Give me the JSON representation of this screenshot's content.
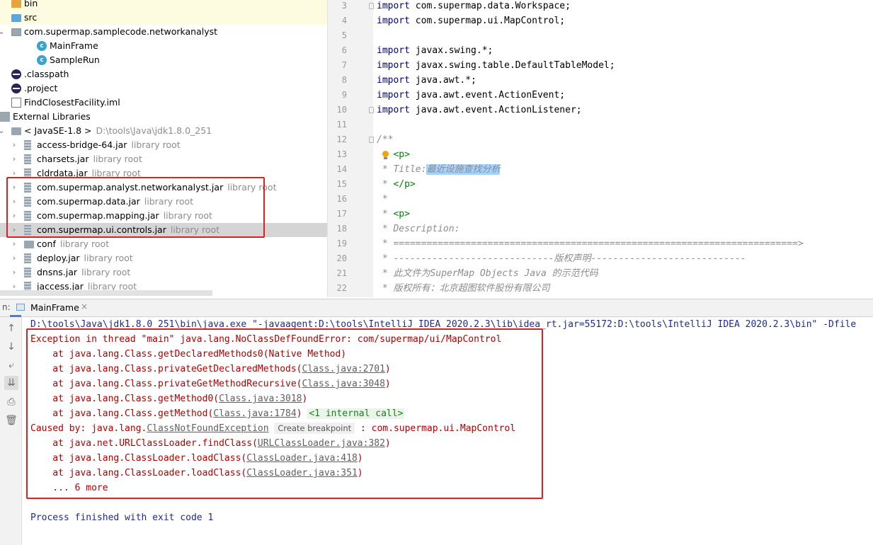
{
  "project_tree": {
    "items": [
      {
        "label": "bin",
        "sub": "",
        "icon": "folder-orange-icon"
      },
      {
        "label": "src",
        "sub": "",
        "icon": "folder-blue-icon"
      },
      {
        "label": "com.supermap.samplecode.networkanalyst",
        "sub": "",
        "icon": "package-icon"
      },
      {
        "label": "MainFrame",
        "sub": "",
        "icon": "java-class-icon"
      },
      {
        "label": "SampleRun",
        "sub": "",
        "icon": "java-class-icon"
      },
      {
        "label": ".classpath",
        "sub": "",
        "icon": "eclipse-icon"
      },
      {
        "label": ".project",
        "sub": "",
        "icon": "eclipse-icon"
      },
      {
        "label": "FindClosestFacility.iml",
        "sub": "",
        "icon": "file-icon"
      },
      {
        "label": "External Libraries",
        "sub": "",
        "icon": "libraries-icon"
      },
      {
        "label": "< JavaSE-1.8 >",
        "sub": "D:\\tools\\Java\\jdk1.8.0_251",
        "icon": "jdk-folder-icon"
      },
      {
        "label": "access-bridge-64.jar",
        "sub": "library root",
        "icon": "jar-icon"
      },
      {
        "label": "charsets.jar",
        "sub": "library root",
        "icon": "jar-icon"
      },
      {
        "label": "cldrdata.jar",
        "sub": "library root",
        "icon": "jar-icon"
      },
      {
        "label": "com.supermap.analyst.networkanalyst.jar",
        "sub": "library root",
        "icon": "jar-icon"
      },
      {
        "label": "com.supermap.data.jar",
        "sub": "library root",
        "icon": "jar-icon"
      },
      {
        "label": "com.supermap.mapping.jar",
        "sub": "library root",
        "icon": "jar-icon"
      },
      {
        "label": "com.supermap.ui.controls.jar",
        "sub": "library root",
        "icon": "jar-icon"
      },
      {
        "label": "conf",
        "sub": "library root",
        "icon": "folder-icon"
      },
      {
        "label": "deploy.jar",
        "sub": "library root",
        "icon": "jar-icon"
      },
      {
        "label": "dnsns.jar",
        "sub": "library root",
        "icon": "jar-icon"
      },
      {
        "label": "jaccess.jar",
        "sub": "library root",
        "icon": "jar-icon"
      }
    ]
  },
  "editor": {
    "lines": [
      {
        "num": "3",
        "kw": "import",
        "text": " com.supermap.data.Workspace;"
      },
      {
        "num": "4",
        "kw": "import",
        "text": " com.supermap.ui.MapControl;"
      },
      {
        "num": "5",
        "kw": "",
        "text": ""
      },
      {
        "num": "6",
        "kw": "import",
        "text": " javax.swing.*;"
      },
      {
        "num": "7",
        "kw": "import",
        "text": " javax.swing.table.DefaultTableModel;"
      },
      {
        "num": "8",
        "kw": "import",
        "text": " java.awt.*;"
      },
      {
        "num": "9",
        "kw": "import",
        "text": " java.awt.event.ActionEvent;"
      },
      {
        "num": "10",
        "kw": "import",
        "text": " java.awt.event.ActionListener;"
      },
      {
        "num": "11",
        "kw": "",
        "text": ""
      },
      {
        "num": "12",
        "kw": "",
        "text": "/**"
      },
      {
        "num": "13",
        "kw": "",
        "text": "<p>"
      },
      {
        "num": "14",
        "kw": "",
        "text": " * Title:",
        "selected": "最近设施查找分析"
      },
      {
        "num": "15",
        "kw": "",
        "text": "</p>"
      },
      {
        "num": "16",
        "kw": "",
        "text": " *"
      },
      {
        "num": "17",
        "kw": "",
        "text": "<p>"
      },
      {
        "num": "18",
        "kw": "",
        "text": " * Description:"
      },
      {
        "num": "19",
        "kw": "",
        "text": " * =========================================================================>"
      },
      {
        "num": "20",
        "kw": "",
        "text": " * -----------------------------版权声明----------------------------"
      },
      {
        "num": "21",
        "kw": "",
        "text": " * 此文件为SuperMap Objects Java 的示范代码"
      },
      {
        "num": "22",
        "kw": "",
        "text": " * 版权所有：北京超图软件股份有限公司"
      }
    ]
  },
  "run_panel": {
    "label": "n:",
    "tab_label": "MainFrame",
    "tab_close": "×",
    "command": "D:\\tools\\Java\\jdk1.8.0_251\\bin\\java.exe \"-javaagent:D:\\tools\\IntelliJ IDEA 2020.2.3\\lib\\idea_rt.jar=55172:D:\\tools\\IntelliJ IDEA 2020.2.3\\bin\" -Dfile",
    "exception": "Exception in thread \"main\" java.lang.NoClassDefFoundError: com/supermap/ui/MapControl",
    "trace1": [
      {
        "pre": "    at java.lang.Class.getDeclaredMethods0(Native Method)",
        "link": "",
        "post": ""
      },
      {
        "pre": "    at java.lang.Class.privateGetDeclaredMethods(",
        "link": "Class.java:2701",
        "post": ")"
      },
      {
        "pre": "    at java.lang.Class.privateGetMethodRecursive(",
        "link": "Class.java:3048",
        "post": ")"
      },
      {
        "pre": "    at java.lang.Class.getMethod0(",
        "link": "Class.java:3018",
        "post": ")"
      },
      {
        "pre": "    at java.lang.Class.getMethod(",
        "link": "Class.java:1784",
        "post": ") "
      }
    ],
    "internal_call": "<1 internal call>",
    "caused_by_pre": "Caused by: java.lang.",
    "caused_by_link": "ClassNotFoundException",
    "create_breakpoint": "Create breakpoint",
    "caused_by_post": " : com.supermap.ui.MapControl",
    "trace2": [
      {
        "pre": "    at java.net.URLClassLoader.findClass(",
        "link": "URLClassLoader.java:382",
        "post": ")"
      },
      {
        "pre": "    at java.lang.ClassLoader.loadClass(",
        "link": "ClassLoader.java:418",
        "post": ")"
      },
      {
        "pre": "    at java.lang.ClassLoader.loadClass(",
        "link": "ClassLoader.java:351",
        "post": ")"
      }
    ],
    "more": "    ... 6 more",
    "finished": "Process finished with exit code 1"
  },
  "colors": {
    "annotation_red": "#e02020",
    "error_text": "#b00000",
    "keyword": "#000080",
    "selection": "#a6d2ff"
  }
}
